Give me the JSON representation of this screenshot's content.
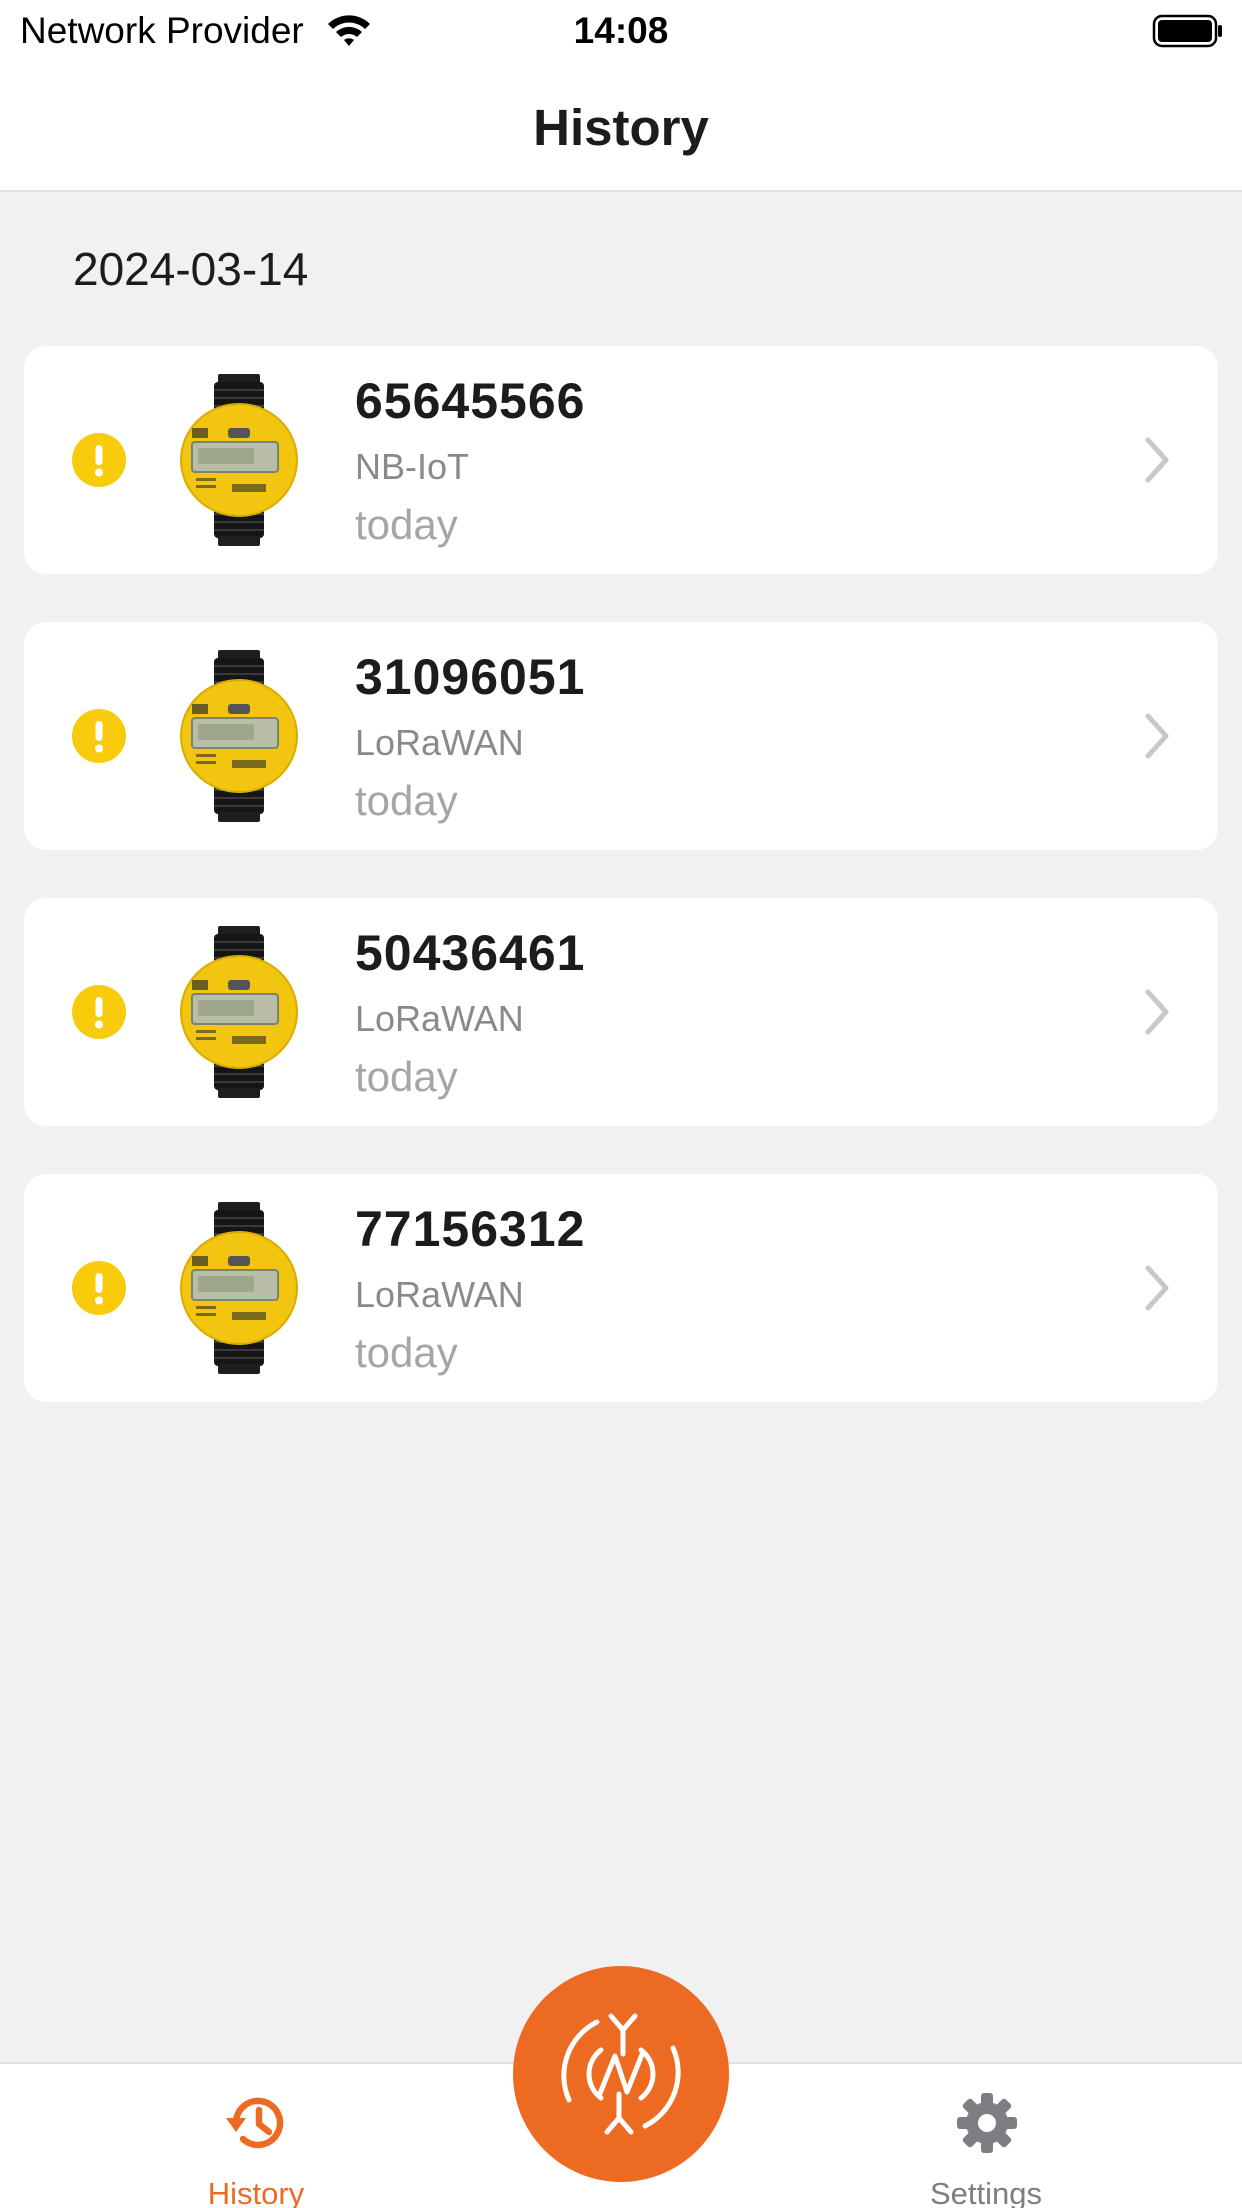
{
  "status_bar": {
    "carrier": "Network Provider",
    "time": "14:08"
  },
  "nav": {
    "title": "History"
  },
  "history": {
    "date": "2024-03-14",
    "items": [
      {
        "serial": "65645566",
        "network": "NB-IoT",
        "time": "today",
        "status_icon": "warning-icon"
      },
      {
        "serial": "31096051",
        "network": "LoRaWAN",
        "time": "today",
        "status_icon": "warning-icon"
      },
      {
        "serial": "50436461",
        "network": "LoRaWAN",
        "time": "today",
        "status_icon": "warning-icon"
      },
      {
        "serial": "77156312",
        "network": "LoRaWAN",
        "time": "today",
        "status_icon": "warning-icon"
      }
    ]
  },
  "tab_bar": {
    "history_label": "History",
    "settings_label": "Settings",
    "scan_icon": "nfc-sync-icon"
  },
  "colors": {
    "accent": "#ec6a22",
    "warning": "#f8cc0d",
    "background": "#f1f1f1",
    "inactive": "#7d7d82"
  }
}
